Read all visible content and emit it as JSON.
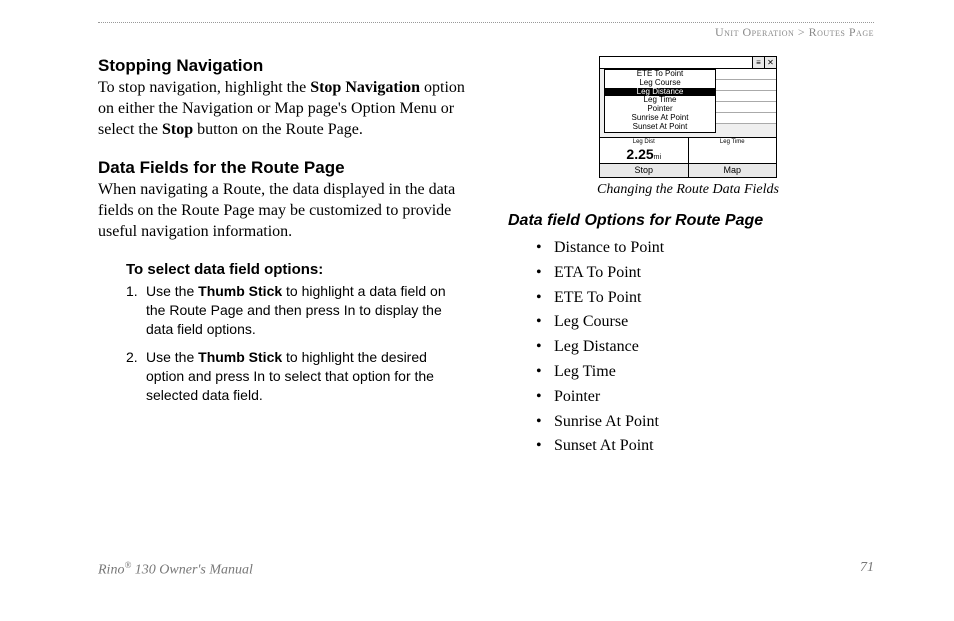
{
  "header": {
    "breadcrumb_section": "Unit Operation",
    "breadcrumb_sep": " > ",
    "breadcrumb_page": "Routes Page"
  },
  "left": {
    "h1": "Stopping Navigation",
    "p1_a": "To stop navigation, highlight the ",
    "p1_b": "Stop Navigation",
    "p1_c": " option on either the Navigation or Map page's Option Menu or select the ",
    "p1_d": "Stop",
    "p1_e": " button on the Route Page.",
    "h2": "Data Fields for the Route Page",
    "p2": "When navigating a Route, the data displayed in the data fields on the Route Page may be customized to provide useful navigation information.",
    "h3": "To select data field options:",
    "steps": [
      {
        "n": "1.",
        "a": "Use the ",
        "b": "Thumb Stick",
        "c": " to highlight a data field on the Route Page and then press In to display the data field options."
      },
      {
        "n": "2.",
        "a": "Use the ",
        "b": "Thumb Stick",
        "c": " to highlight the desired option and press In to select that option for the selected data field."
      }
    ]
  },
  "right": {
    "caption": "Changing the Route Data Fields",
    "h3": "Data field Options for Route Page",
    "options": [
      "Distance to Point",
      "ETA To Point",
      "ETE To Point",
      "Leg Course",
      "Leg Distance",
      "Leg Time",
      "Pointer",
      "Sunrise At Point",
      "Sunset At Point"
    ]
  },
  "device": {
    "list": [
      {
        "t": "ETE To Point",
        "sel": false
      },
      {
        "t": "Leg Course",
        "sel": false
      },
      {
        "t": "Leg Distance",
        "sel": true
      },
      {
        "t": "Leg Time",
        "sel": false
      },
      {
        "t": "Pointer",
        "sel": false
      },
      {
        "t": "Sunrise At Point",
        "sel": false
      },
      {
        "t": "Sunset At Point",
        "sel": false
      }
    ],
    "data_left_label": "Leg Dist",
    "data_left_value": "2.25",
    "data_left_unit": "mi",
    "data_right_label": "Leg Time",
    "btn_left": "Stop",
    "btn_right": "Map",
    "tbtn1": "≡",
    "tbtn2": "✕"
  },
  "footer": {
    "product_a": "Rino",
    "product_sup": "®",
    "product_b": " 130 Owner's Manual",
    "page": "71"
  }
}
